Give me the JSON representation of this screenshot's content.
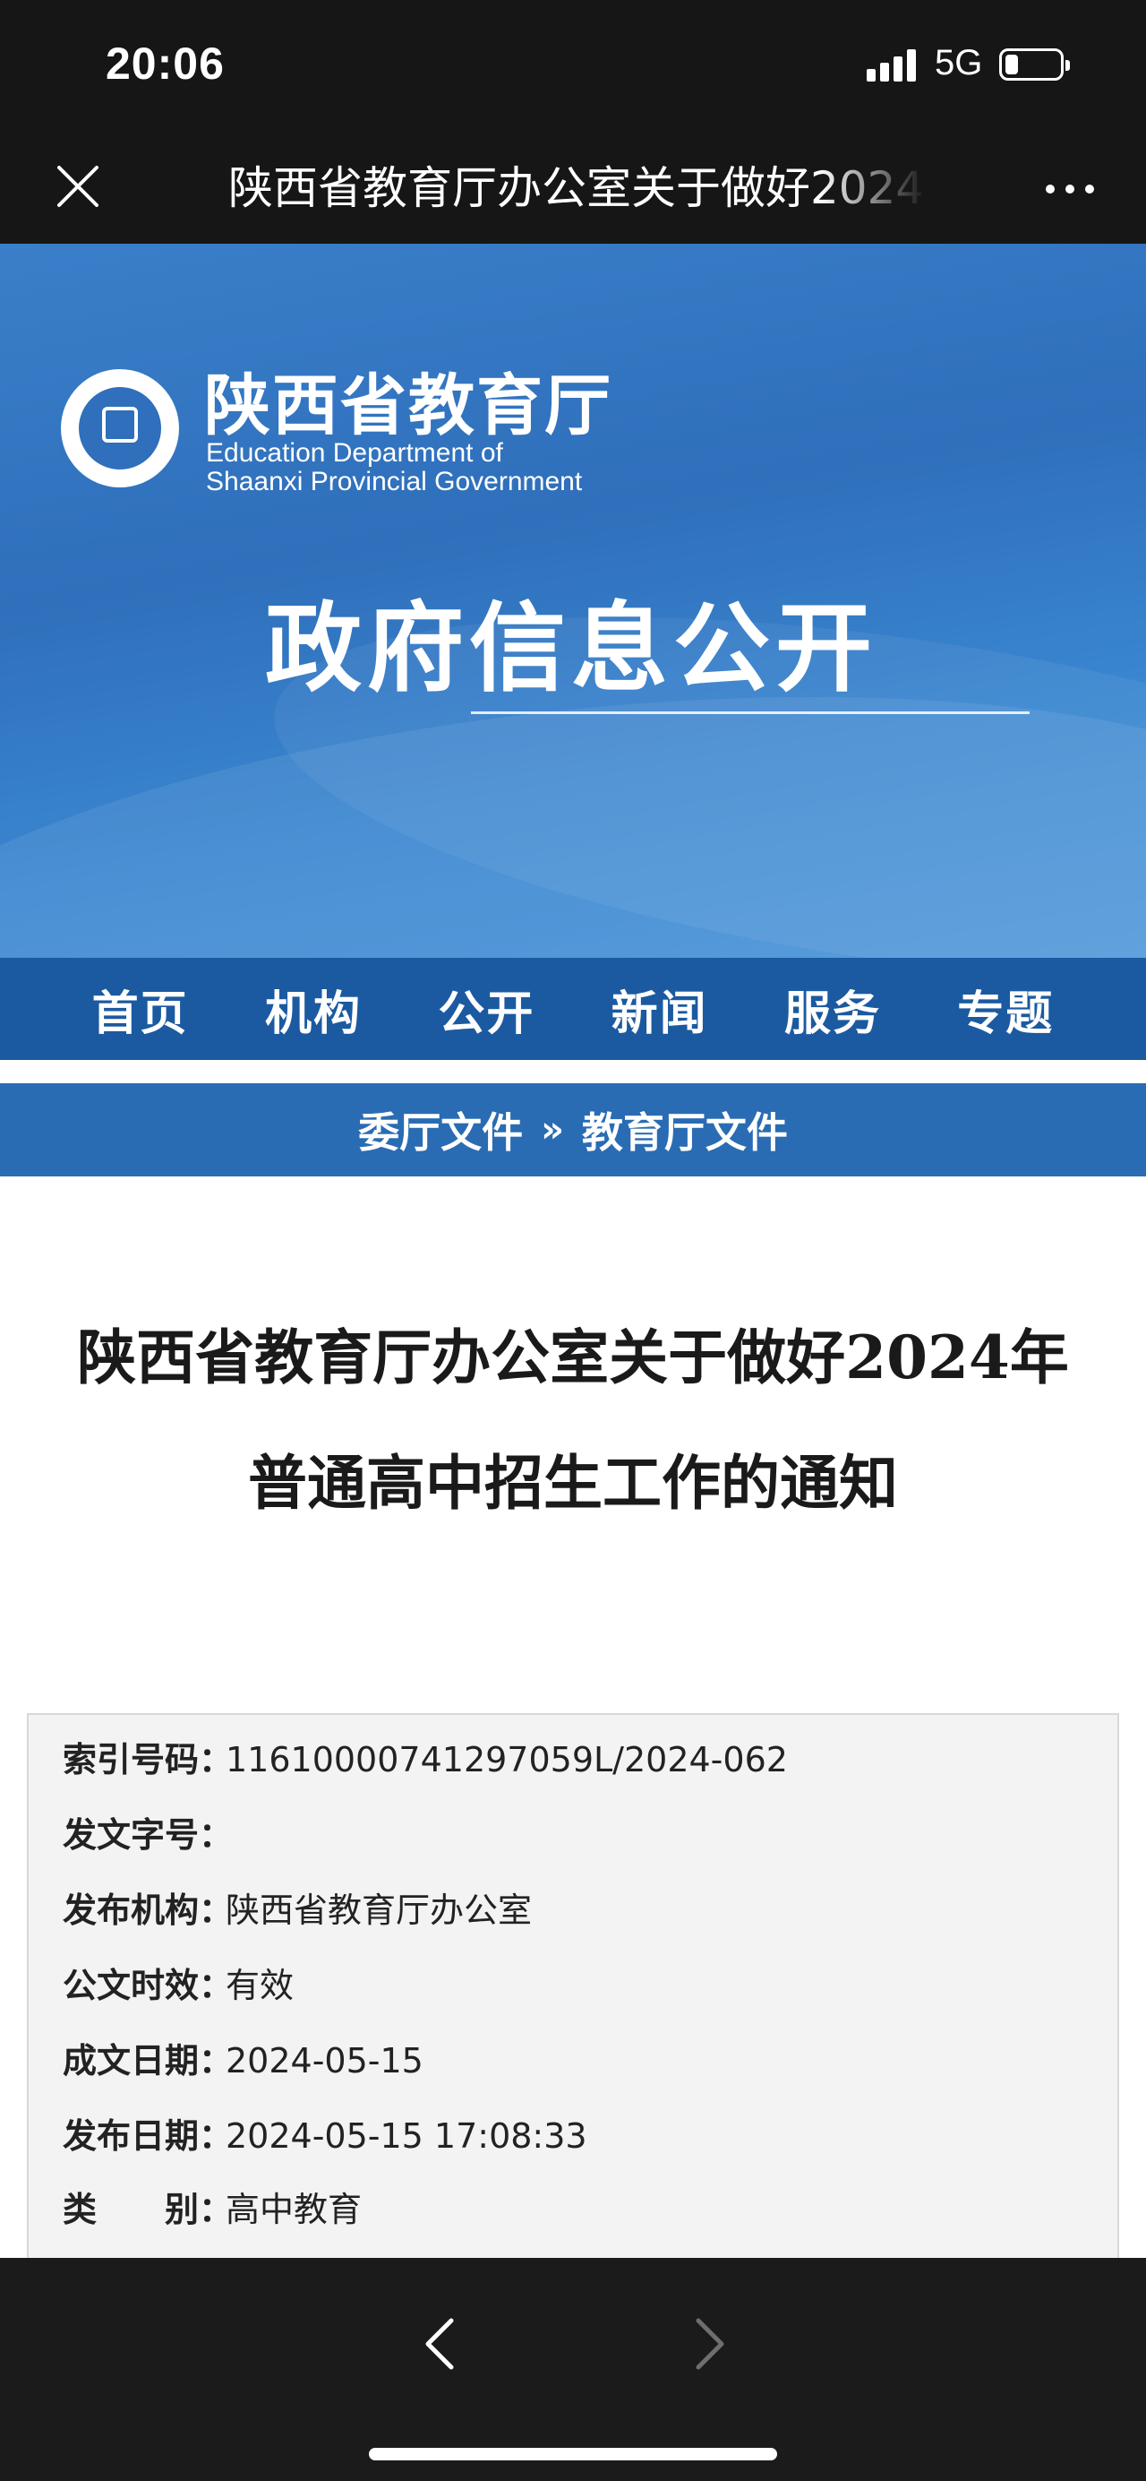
{
  "status_bar": {
    "time": "20:06",
    "network": "5G",
    "icons": [
      "signal-icon",
      "battery-icon"
    ]
  },
  "nav_bar": {
    "title": "陕西省教育厅办公室关于做好2024年普通高中招生工作的通知",
    "icons": [
      "close-icon",
      "more-icon"
    ]
  },
  "banner": {
    "logo_cn": "陕西省教育厅",
    "logo_en_line1": "Education Department of",
    "logo_en_line2": "Shaanxi Provincial Government",
    "heading": "政府信息公开"
  },
  "main_menu": {
    "items": [
      {
        "label": "首页"
      },
      {
        "label": "机构"
      },
      {
        "label": "公开"
      },
      {
        "label": "新闻"
      },
      {
        "label": "服务"
      },
      {
        "label": "专题"
      }
    ]
  },
  "breadcrumb": {
    "items": [
      "委厅文件",
      "教育厅文件"
    ],
    "separator": "»"
  },
  "article": {
    "title_line1": "陕西省教育厅办公室关于做好2024年",
    "title_line2": "普通高中招生工作的通知"
  },
  "meta": {
    "rows": [
      {
        "label": "索引号码：",
        "value": "11610000741297059L/2024-062"
      },
      {
        "label": "发文字号：",
        "value": ""
      },
      {
        "label": "发布机构：",
        "value": "陕西省教育厅办公室"
      },
      {
        "label": "公文时效：",
        "value": "有效"
      },
      {
        "label": "成文日期：",
        "value": "2024-05-15"
      },
      {
        "label": "发布日期：",
        "value": "2024-05-15 17:08:33"
      },
      {
        "label": "类　　别：",
        "value": "高中教育"
      }
    ]
  },
  "toolbar": {
    "icons": [
      "back-chevron-icon",
      "forward-chevron-icon"
    ]
  },
  "colors": {
    "menu_blue": "#1b5aa0",
    "breadcrumb_blue": "#2a6cb3",
    "banner_blue": "#2f6fbb",
    "dark_chrome": "#161616"
  }
}
